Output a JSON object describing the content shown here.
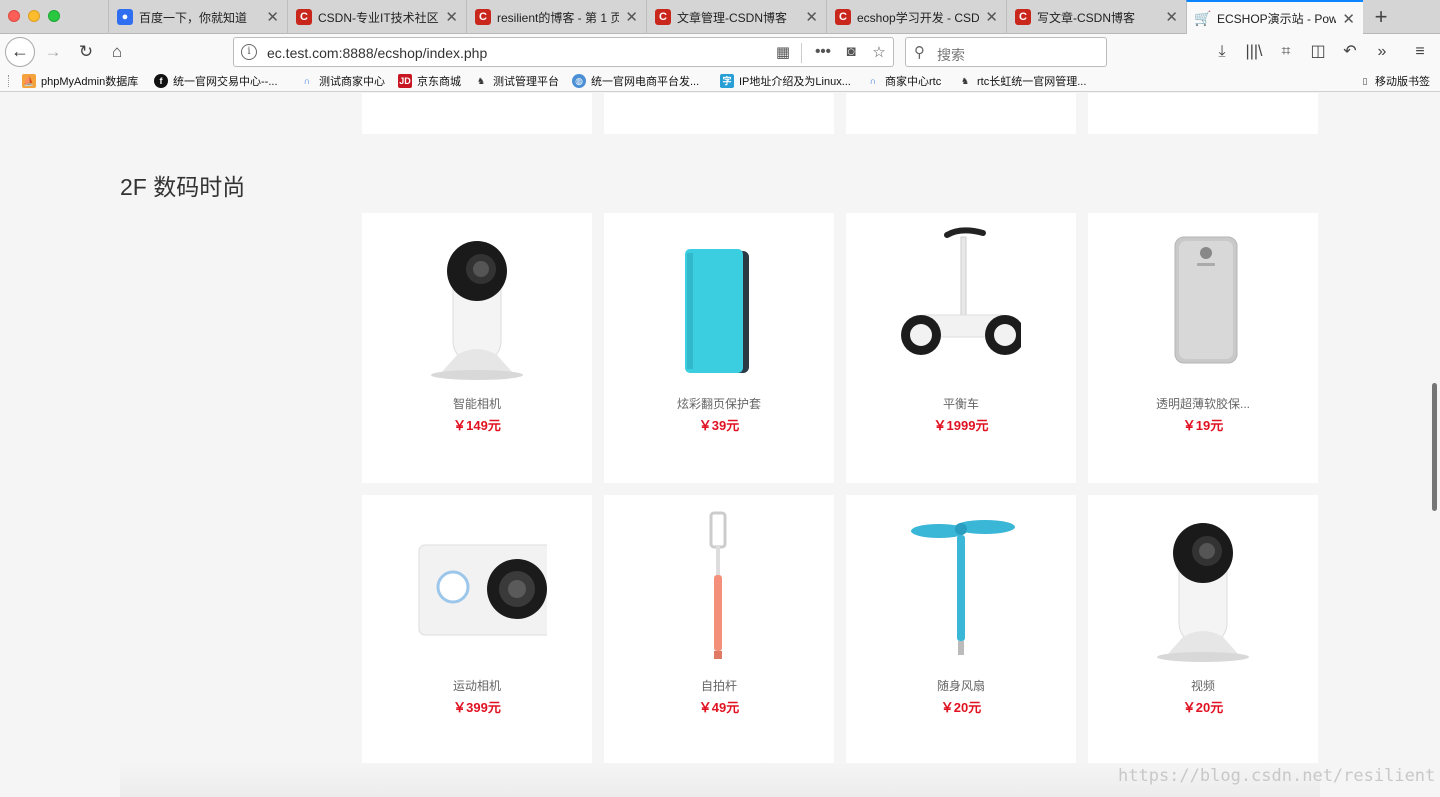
{
  "browser": {
    "tabs": [
      {
        "title": "百度一下，你就知道",
        "icon": "baidu-paw-icon"
      },
      {
        "title": "CSDN-专业IT技术社区",
        "icon": "csdn-icon"
      },
      {
        "title": "resilient的博客 - 第 1 页",
        "icon": "csdn-icon"
      },
      {
        "title": "文章管理-CSDN博客",
        "icon": "csdn-icon"
      },
      {
        "title": "ecshop学习开发 - CSDN",
        "icon": "csdn-icon"
      },
      {
        "title": "写文章-CSDN博客",
        "icon": "csdn-icon"
      },
      {
        "title": "ECSHOP演示站 - Powered",
        "icon": "shopping-cart-icon",
        "active": true
      }
    ],
    "url": "ec.test.com:8888/ecshop/index.php",
    "search_placeholder": "搜索",
    "bookmarks": [
      "phpMyAdmin数据库",
      "统一官网交易中心--...",
      "测试商家中心",
      "京东商城",
      "测试管理平台",
      "统一官网电商平台发...",
      "IP地址介绍及为Linux...",
      "商家中心rtc",
      "rtc长虹统一官网管理..."
    ],
    "mobile_bookmarks": "移动版书签"
  },
  "floor": {
    "title": "2F 数码时尚",
    "products": [
      {
        "name": "智能相机",
        "price": "￥149元",
        "image": "smart-camera"
      },
      {
        "name": "炫彩翻页保护套",
        "price": "￥39元",
        "image": "flip-case"
      },
      {
        "name": "平衡车",
        "price": "￥1999元",
        "image": "balance-scooter"
      },
      {
        "name": "透明超薄软胶保...",
        "price": "￥19元",
        "image": "clear-phone-case"
      },
      {
        "name": "运动相机",
        "price": "￥399元",
        "image": "action-camera"
      },
      {
        "name": "自拍杆",
        "price": "￥49元",
        "image": "selfie-stick"
      },
      {
        "name": "随身风扇",
        "price": "￥20元",
        "image": "usb-fan"
      },
      {
        "name": "视频",
        "price": "￥20元",
        "image": "smart-camera"
      }
    ]
  },
  "watermark": "https://blog.csdn.net/resilient",
  "colors": {
    "price": "#e01222",
    "tab_accent": "#0a84ff",
    "csdn": "#c9271c"
  }
}
